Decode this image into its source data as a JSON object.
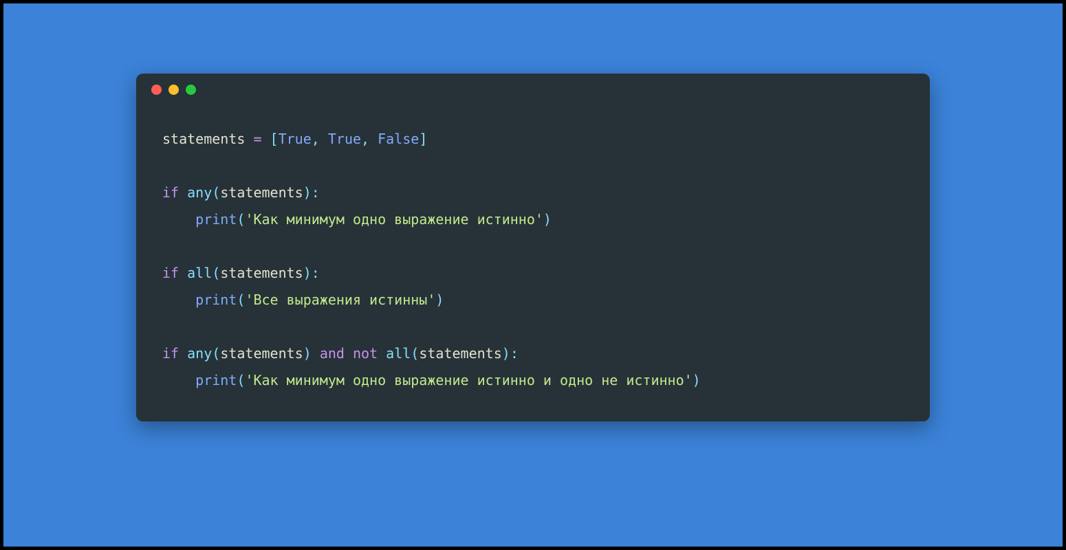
{
  "colors": {
    "background": "#3b82d8",
    "editor_bg": "#263238",
    "dot_red": "#ff5f56",
    "dot_yellow": "#ffbd2e",
    "dot_green": "#27c93f",
    "token_name": "#e6e1cf",
    "token_operator": "#c792ea",
    "token_punct": "#89ddff",
    "token_bool": "#82aaff",
    "token_keyword": "#c792ea",
    "token_func": "#89ddff",
    "token_call": "#82aaff",
    "token_string": "#c3e88d"
  },
  "code": {
    "line1": {
      "var": "statements",
      "eq": " = ",
      "lb": "[",
      "v1": "True",
      "c1": ", ",
      "v2": "True",
      "c2": ", ",
      "v3": "False",
      "rb": "]"
    },
    "line3": {
      "kw": "if",
      "sp1": " ",
      "fn": "any",
      "lp": "(",
      "arg": "statements",
      "rp": ")",
      "colon": ":"
    },
    "line4": {
      "indent": "    ",
      "fn": "print",
      "lp": "(",
      "str": "'Как минимум одно выражение истинно'",
      "rp": ")"
    },
    "line6": {
      "kw": "if",
      "sp1": " ",
      "fn": "all",
      "lp": "(",
      "arg": "statements",
      "rp": ")",
      "colon": ":"
    },
    "line7": {
      "indent": "    ",
      "fn": "print",
      "lp": "(",
      "str": "'Все выражения истинны'",
      "rp": ")"
    },
    "line9": {
      "kw1": "if",
      "sp1": " ",
      "fn1": "any",
      "lp1": "(",
      "arg1": "statements",
      "rp1": ")",
      "sp2": " ",
      "kw2": "and",
      "sp3": " ",
      "kw3": "not",
      "sp4": " ",
      "fn2": "all",
      "lp2": "(",
      "arg2": "statements",
      "rp2": ")",
      "colon": ":"
    },
    "line10": {
      "indent": "    ",
      "fn": "print",
      "lp": "(",
      "str": "'Как минимум одно выражение истинно и одно не истинно'",
      "rp": ")"
    }
  }
}
